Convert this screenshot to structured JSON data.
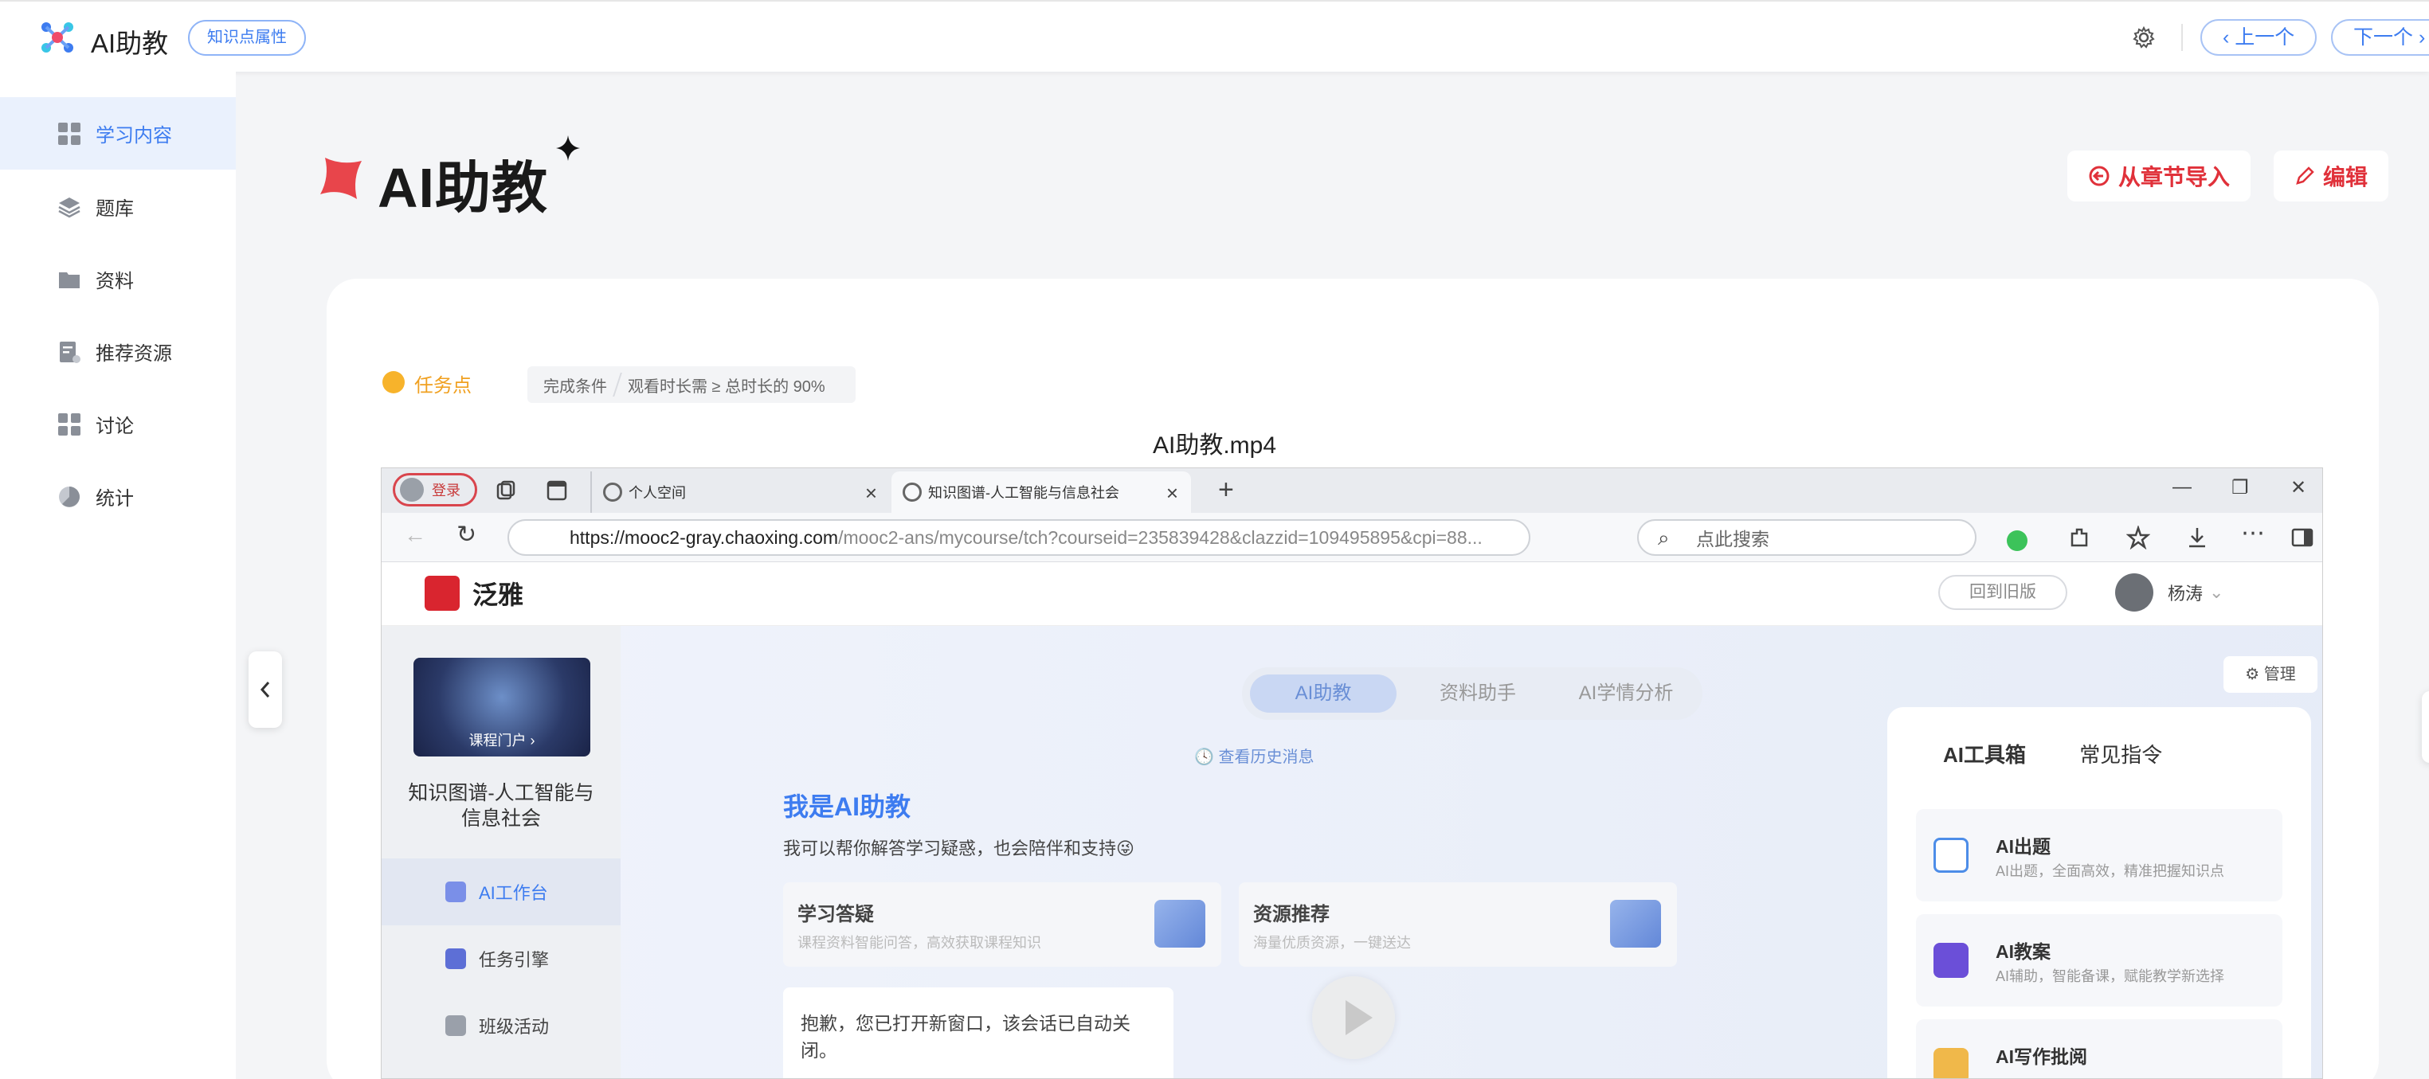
{
  "topbar": {
    "app_title": "AI助教",
    "badge": "知识点属性",
    "prev": "上一个",
    "next": "下一个"
  },
  "sidebar": {
    "items": [
      {
        "label": "学习内容",
        "icon": "grid-icon",
        "active": true
      },
      {
        "label": "题库",
        "icon": "layers-icon"
      },
      {
        "label": "资料",
        "icon": "folder-icon"
      },
      {
        "label": "推荐资源",
        "icon": "doc-badge-icon"
      },
      {
        "label": "讨论",
        "icon": "grid-icon"
      },
      {
        "label": "统计",
        "icon": "pie-chart-icon"
      }
    ]
  },
  "header": {
    "title": "AI助教",
    "import_label": "从章节导入",
    "edit_label": "编辑"
  },
  "task": {
    "label": "任务点",
    "cond_label": "完成条件",
    "cond_value": "观看时长需 ≥ 总时长的 90%"
  },
  "video": {
    "filename": "AI助教.mp4",
    "browser": {
      "login": "登录",
      "tab1": "个人空间",
      "tab2": "知识图谱-人工智能与信息社会",
      "url_host": "https://mooc2-gray.chaoxing.com",
      "url_rest": "/mooc2-ans/mycourse/tch?courseid=235839428&clazzid=109495895&cpi=88...",
      "search_placeholder": "点此搜索"
    },
    "app": {
      "brand": "泛雅",
      "old_version": "回到旧版",
      "user": "杨涛",
      "course_portal": "课程门户 ›",
      "course_name": "知识图谱-人工智能与信息社会",
      "left_nav": [
        "AI工作台",
        "任务引擎",
        "班级活动"
      ],
      "seg_tabs": [
        "AI助教",
        "资料助手",
        "AI学情分析"
      ],
      "history": "查看历史消息",
      "intro_title": "我是AI助教",
      "intro_sub": "我可以帮你解答学习疑惑，也会陪伴和支持😜",
      "cards": [
        {
          "title": "学习答疑",
          "desc": "课程资料智能问答，高效获取课程知识"
        },
        {
          "title": "资源推荐",
          "desc": "海量优质资源，一键送达"
        }
      ],
      "message": "抱歉，您已打开新窗口，该会话已自动关闭。",
      "manage": "管理",
      "toolbox_tabs": [
        "AI工具箱",
        "常见指令"
      ],
      "tools": [
        {
          "name": "AI出题",
          "desc": "AI出题，全面高效，精准把握知识点"
        },
        {
          "name": "AI教案",
          "desc": "AI辅助，智能备课，赋能教学新选择"
        },
        {
          "name": "AI写作批阅",
          "desc": ""
        }
      ]
    }
  }
}
